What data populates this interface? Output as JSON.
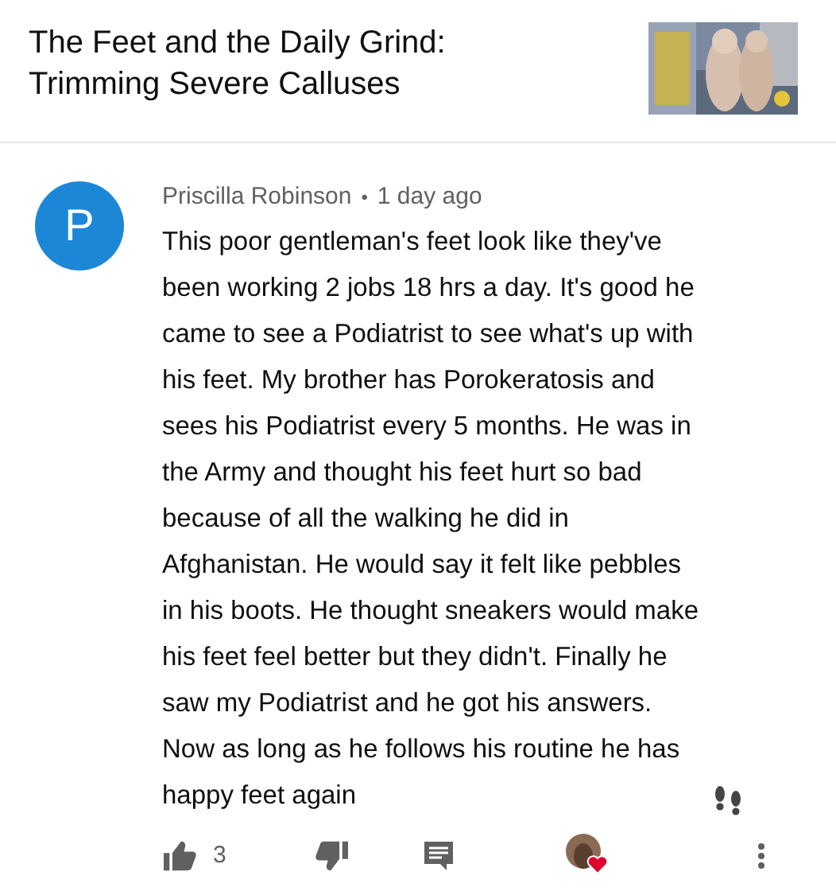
{
  "video": {
    "title": "The Feet and the Daily Grind: Trimming Severe Calluses"
  },
  "comment": {
    "avatar_letter": "P",
    "author": "Priscilla Robinson",
    "separator": "•",
    "time": "1 day ago",
    "text": "This poor gentleman's feet look like they've been working 2 jobs 18 hrs a day. It's good he came to see a Podiatrist to see what's up with his feet. My brother has Porokeratosis and sees his Podiatrist every 5 months. He was in the Army and thought his feet hurt so bad because of all the walking he did in Afghanistan. He would say it felt like pebbles in his boots. He thought sneakers would make his feet feel better but they didn't. Finally he saw my Podiatrist and he got his answers. Now as long as he follows his routine he has happy feet again",
    "like_count": "3",
    "hearted": true
  }
}
